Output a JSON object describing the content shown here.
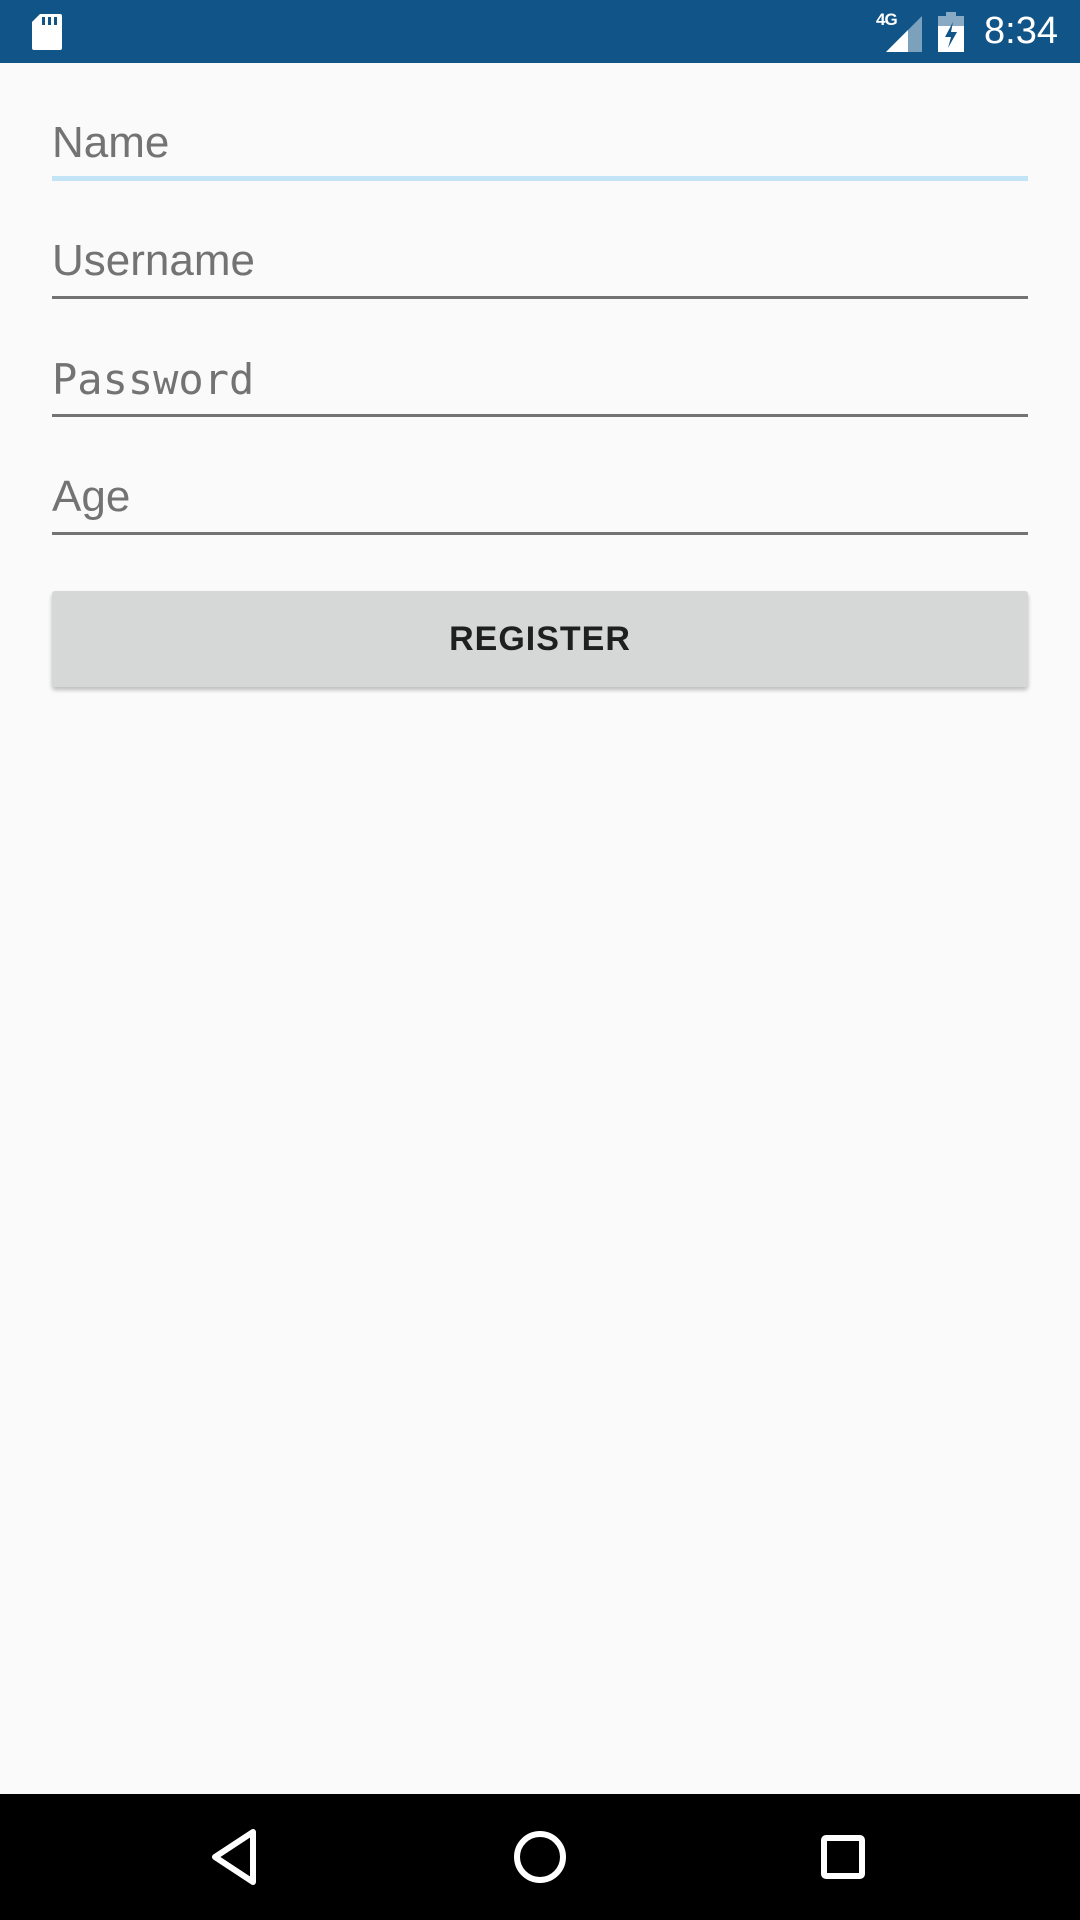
{
  "status_bar": {
    "left_icon": "sd-card-icon",
    "network_type": "4G",
    "signal_icon": "cell-signal-icon",
    "battery_icon": "battery-charging-icon",
    "time": "8:34",
    "background_color": "#115588"
  },
  "form": {
    "name": {
      "placeholder": "Name",
      "value": ""
    },
    "username": {
      "placeholder": "Username",
      "value": ""
    },
    "password": {
      "placeholder": "Password",
      "value": ""
    },
    "age": {
      "placeholder": "Age",
      "value": ""
    },
    "focused_field": "name",
    "focus_color": "#c3e4f7"
  },
  "register_button": {
    "label": "REGISTER"
  },
  "nav_bar": {
    "back_icon": "back-triangle-icon",
    "home_icon": "home-circle-icon",
    "recent_icon": "recent-apps-square-icon"
  }
}
